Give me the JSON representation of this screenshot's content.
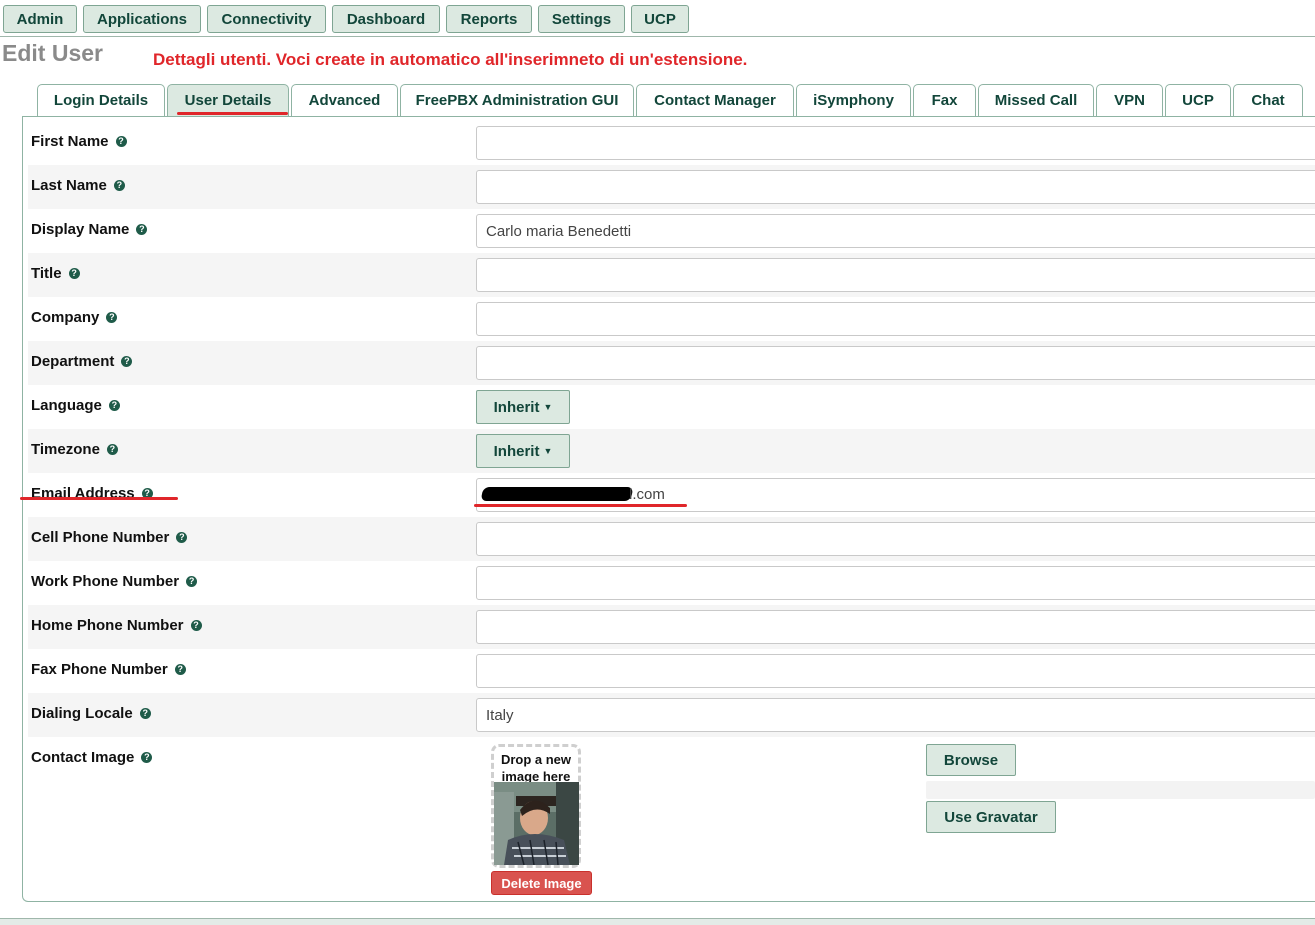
{
  "nav": {
    "items": [
      {
        "label": "Admin"
      },
      {
        "label": "Applications"
      },
      {
        "label": "Connectivity"
      },
      {
        "label": "Dashboard"
      },
      {
        "label": "Reports"
      },
      {
        "label": "Settings"
      },
      {
        "label": "UCP"
      }
    ]
  },
  "page": {
    "title": "Edit User",
    "annotation": "Dettagli utenti. Voci create in automatico all'inserimneto di un'estensione."
  },
  "tabs": [
    {
      "label": "Login Details",
      "active": false
    },
    {
      "label": "User Details",
      "active": true
    },
    {
      "label": "Advanced",
      "active": false
    },
    {
      "label": "FreePBX Administration GUI",
      "active": false
    },
    {
      "label": "Contact Manager",
      "active": false
    },
    {
      "label": "iSymphony",
      "active": false
    },
    {
      "label": "Fax",
      "active": false
    },
    {
      "label": "Missed Call",
      "active": false
    },
    {
      "label": "VPN",
      "active": false
    },
    {
      "label": "UCP",
      "active": false
    },
    {
      "label": "Chat",
      "active": false
    }
  ],
  "form": {
    "first_name": {
      "label": "First Name",
      "value": ""
    },
    "last_name": {
      "label": "Last Name",
      "value": ""
    },
    "display_name": {
      "label": "Display Name",
      "value": "Carlo maria Benedetti"
    },
    "title": {
      "label": "Title",
      "value": ""
    },
    "company": {
      "label": "Company",
      "value": ""
    },
    "department": {
      "label": "Department",
      "value": ""
    },
    "language": {
      "label": "Language",
      "value": "Inherit"
    },
    "timezone": {
      "label": "Timezone",
      "value": "Inherit"
    },
    "email": {
      "label": "Email Address",
      "value_visible_suffix": "l.com"
    },
    "cell_phone": {
      "label": "Cell Phone Number",
      "value": ""
    },
    "work_phone": {
      "label": "Work Phone Number",
      "value": ""
    },
    "home_phone": {
      "label": "Home Phone Number",
      "value": ""
    },
    "fax_phone": {
      "label": "Fax Phone Number",
      "value": ""
    },
    "dialing_locale": {
      "label": "Dialing Locale",
      "value": "Italy"
    },
    "contact_image": {
      "label": "Contact Image",
      "drop_text": "Drop a new image here",
      "delete_label": "Delete Image",
      "browse_label": "Browse",
      "gravatar_label": "Use Gravatar"
    }
  },
  "icons": {
    "help": "question-circle-icon",
    "caret": "caret-down-icon"
  },
  "colors": {
    "accent": "#12463a",
    "button_bg": "#dce9e1",
    "annotation": "#e0262a",
    "danger": "#d9534f"
  }
}
